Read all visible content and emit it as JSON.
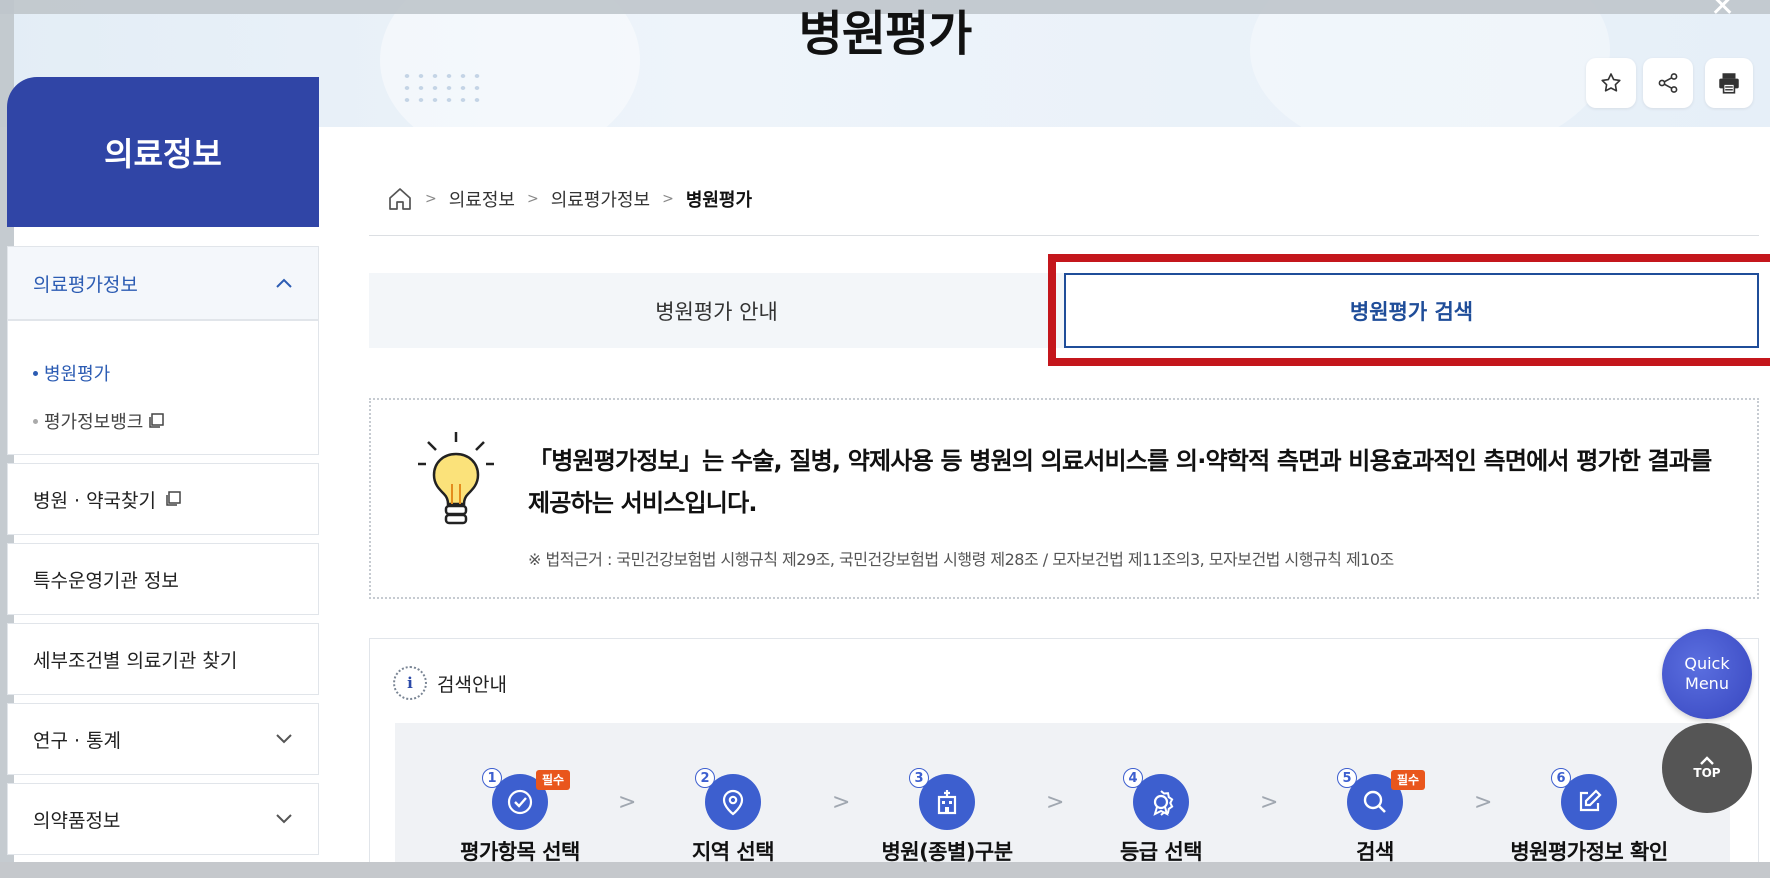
{
  "header": {
    "title": "병원평가",
    "close": "✕"
  },
  "tools": {
    "favorite": "star-icon",
    "share": "share-icon",
    "print": "print-icon"
  },
  "sidebar": {
    "title": "의료정보",
    "open_group": {
      "label": "의료평가정보",
      "items": [
        {
          "label": "병원평가",
          "active": true
        },
        {
          "label": "평가정보뱅크",
          "external": true
        }
      ]
    },
    "items": [
      {
        "label": "병원 · 약국찾기",
        "external": true
      },
      {
        "label": "특수운영기관 정보"
      },
      {
        "label": "세부조건별 의료기관 찾기"
      },
      {
        "label": "연구 · 통계",
        "expandable": true
      },
      {
        "label": "의약품정보",
        "expandable": true
      }
    ]
  },
  "breadcrumb": {
    "items": [
      "의료정보",
      "의료평가정보",
      "병원평가"
    ]
  },
  "tabs": [
    {
      "label": "병원평가 안내",
      "active": false
    },
    {
      "label": "병원평가 검색",
      "active": true
    }
  ],
  "info": {
    "description": "「병원평가정보」는 수술, 질병, 약제사용 등 병원의 의료서비스를 의·약학적 측면과 비용효과적인 측면에서 평가한 결과를 제공하는 서비스입니다.",
    "legal": "※ 법적근거 : 국민건강보험법 시행규칙 제29조, 국민건강보험법 시행령 제28조 / 모자보건법 제11조의3, 모자보건법 시행규칙 제10조"
  },
  "guide": {
    "title": "검색안내",
    "icon_letter": "i",
    "steps": [
      {
        "num": "1",
        "label": "평가항목 선택",
        "required": "필수",
        "icon": "check-icon"
      },
      {
        "num": "2",
        "label": "지역 선택",
        "icon": "location-pin-icon"
      },
      {
        "num": "3",
        "label": "병원(종별)구분",
        "icon": "hospital-icon"
      },
      {
        "num": "4",
        "label": "등급 선택",
        "icon": "award-icon"
      },
      {
        "num": "5",
        "label": "검색",
        "required": "필수",
        "icon": "search-icon"
      },
      {
        "num": "6",
        "label": "병원평가정보 확인",
        "icon": "edit-icon"
      }
    ]
  },
  "floating": {
    "quick_menu": "Quick Menu",
    "top": "TOP"
  }
}
